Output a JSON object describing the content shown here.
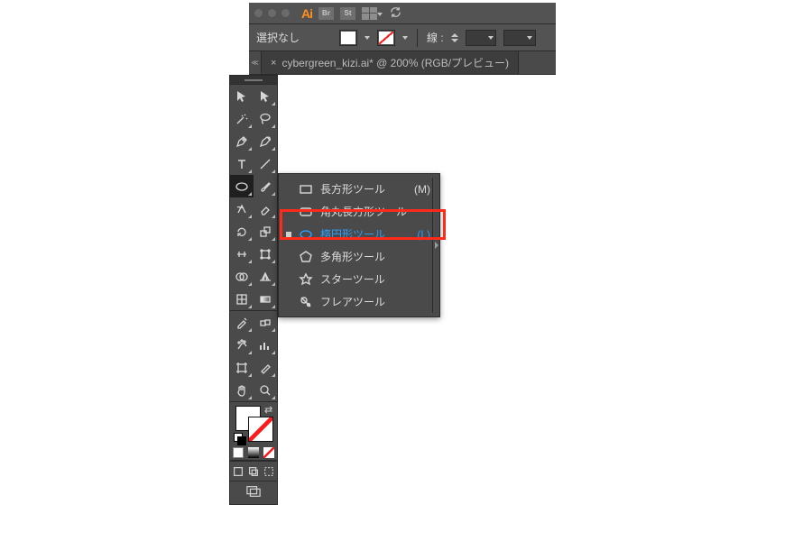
{
  "header": {
    "app_abbrev": "Ai",
    "badge_br": "Br",
    "badge_st": "St"
  },
  "controlbar": {
    "selection_label": "選択なし",
    "stroke_label": "線 :"
  },
  "document_tab": {
    "title": "cybergreen_kizi.ai* @ 200% (RGB/プレビュー)"
  },
  "flyout": {
    "items": [
      {
        "label": "長方形ツール",
        "shortcut": "(M)",
        "icon": "rectangle",
        "selected": false
      },
      {
        "label": "角丸長方形ツール",
        "shortcut": "",
        "icon": "rounded-rect",
        "selected": false
      },
      {
        "label": "楕円形ツール",
        "shortcut": "(L)",
        "icon": "ellipse",
        "selected": true
      },
      {
        "label": "多角形ツール",
        "shortcut": "",
        "icon": "polygon",
        "selected": false
      },
      {
        "label": "スターツール",
        "shortcut": "",
        "icon": "star",
        "selected": false
      },
      {
        "label": "フレアツール",
        "shortcut": "",
        "icon": "flare",
        "selected": false
      }
    ]
  }
}
